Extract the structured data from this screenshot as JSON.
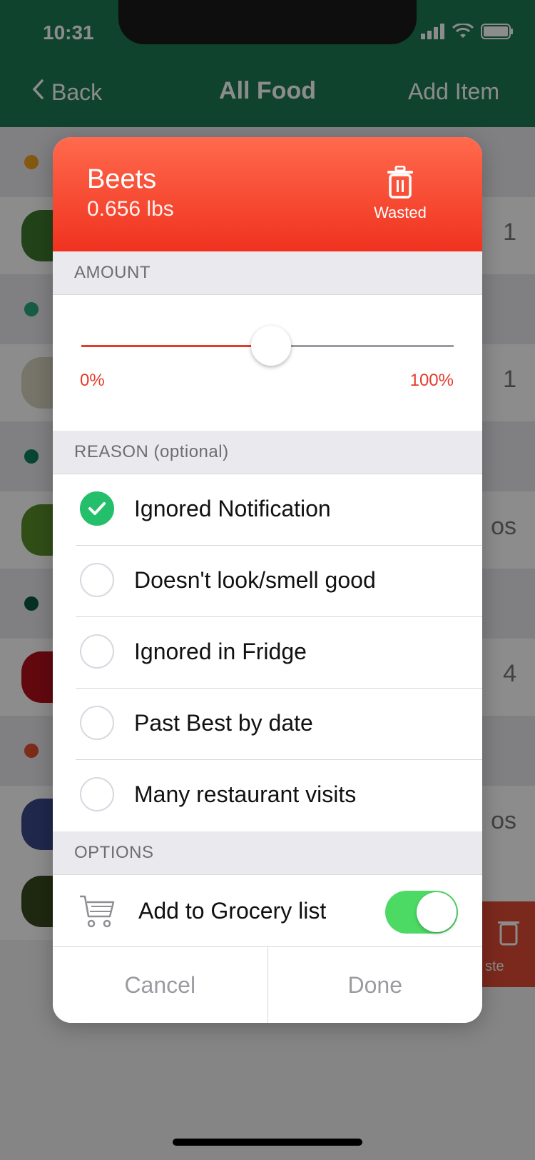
{
  "status": {
    "time": "10:31"
  },
  "nav": {
    "back": "Back",
    "title": "All Food",
    "add": "Add Item"
  },
  "background_peek": [
    "1",
    "1",
    "os",
    "4",
    "os"
  ],
  "swipe": {
    "label": "ste"
  },
  "item": {
    "name": "Beets",
    "weight": "0.656 lbs",
    "action": "Wasted"
  },
  "amount": {
    "header": "AMOUNT",
    "min_label": "0%",
    "max_label": "100%",
    "value_percent": 51
  },
  "reason": {
    "header": "REASON (optional)",
    "items": [
      {
        "label": "Ignored Notification",
        "checked": true
      },
      {
        "label": "Doesn't look/smell good",
        "checked": false
      },
      {
        "label": "Ignored in Fridge",
        "checked": false
      },
      {
        "label": "Past Best by date",
        "checked": false
      },
      {
        "label": "Many restaurant visits",
        "checked": false
      }
    ]
  },
  "options": {
    "header": "OPTIONS",
    "grocery_label": "Add to Grocery list",
    "grocery_on": true
  },
  "buttons": {
    "cancel": "Cancel",
    "done": "Done"
  },
  "colors": {
    "accent_red": "#f0321f",
    "nav_green": "#1e7a52",
    "check_green": "#24bf6a",
    "toggle_green": "#4cd964"
  }
}
